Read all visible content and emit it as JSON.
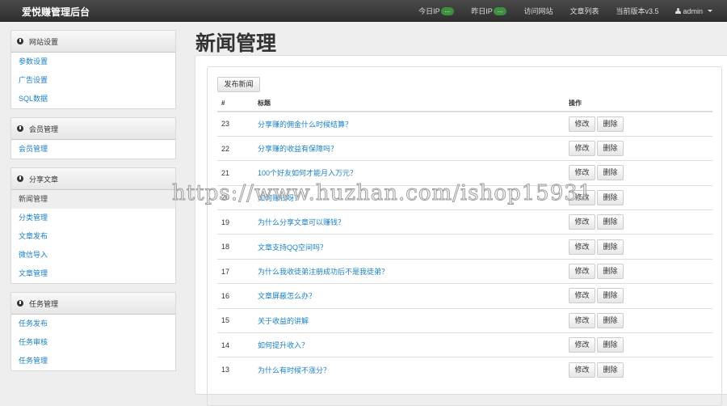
{
  "navbar": {
    "brand": "爱悦赚管理后台",
    "today_ip": "今日IP",
    "today_ip_badge": "...",
    "yesterday_ip": "昨日IP",
    "yesterday_ip_badge": "...",
    "visit_site": "访问网站",
    "article_list": "文章列表",
    "version": "当前版本v3.5",
    "user": "admin"
  },
  "sidebar": [
    {
      "title": "网站设置",
      "items": [
        "参数设置",
        "广告设置",
        "SQL数据"
      ]
    },
    {
      "title": "会员管理",
      "items": [
        "会员管理"
      ]
    },
    {
      "title": "分享文章",
      "items": [
        "新闻管理",
        "分类管理",
        "文章发布",
        "微信导入",
        "文章管理"
      ]
    },
    {
      "title": "任务管理",
      "items": [
        "任务发布",
        "任务审核",
        "任务管理"
      ]
    }
  ],
  "page": {
    "title": "新闻管理",
    "publish_button": "发布新闻"
  },
  "table": {
    "headers": [
      "#",
      "标题",
      "操作"
    ],
    "edit_label": "修改",
    "delete_label": "删除",
    "rows": [
      {
        "id": "23",
        "title": "分享赚的佣金什么时候结算？"
      },
      {
        "id": "22",
        "title": "分享赚的收益有保障吗？"
      },
      {
        "id": "21",
        "title": "100个好友如何才能月入万元？"
      },
      {
        "id": "20",
        "title": "如何赚钱呀？"
      },
      {
        "id": "19",
        "title": "为什么分享文章可以赚钱？"
      },
      {
        "id": "18",
        "title": "文章支持QQ空间吗？"
      },
      {
        "id": "17",
        "title": "为什么我收徒弟注册成功后不是我徒弟？"
      },
      {
        "id": "16",
        "title": "文章屏蔽怎么办？"
      },
      {
        "id": "15",
        "title": "关于收益的讲解"
      },
      {
        "id": "14",
        "title": "如何提升收入？"
      },
      {
        "id": "13",
        "title": "为什么有时候不涨分？"
      }
    ]
  },
  "watermark": "https://www.huzhan.com/ishop15931"
}
